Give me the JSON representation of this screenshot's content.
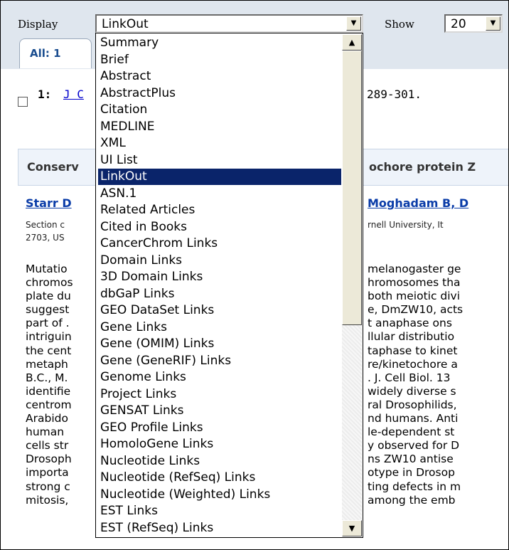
{
  "toolbar": {
    "display_label": "Display",
    "display_value": "LinkOut",
    "show_label": "Show",
    "show_value": "20",
    "dropdown_arrow_icon": "chevron-down-icon"
  },
  "tabs": [
    {
      "label": "All: 1"
    }
  ],
  "result": {
    "number": "1:",
    "link_text": "J C",
    "citation_tail": "289-301."
  },
  "article": {
    "title_left": "Conserv",
    "title_right": "ochore protein Z",
    "authors_left": "Starr D",
    "authors_right": "Moghadam B, D",
    "affiliation_line1_left": "Section c",
    "affiliation_line1_right": "rnell University, It",
    "affiliation_line2_left": "2703, US",
    "abstract_left": [
      "Mutatio",
      "chromos",
      "plate du",
      "suggest",
      "part of .",
      "intriguin",
      "the cent",
      "metaph",
      "B.C., M.",
      "identifie",
      "centrom",
      "Arabido",
      "human",
      "cells str",
      "Drosoph",
      "importa",
      "strong c",
      "mitosis,"
    ],
    "abstract_right": [
      "melanogaster ge",
      "hromosomes tha",
      "both meiotic divi",
      "e, DmZW10, acts",
      "t anaphase ons",
      "llular distributio",
      "taphase to kinet",
      "re/kinetochore a",
      ". J. Cell Biol. 13",
      "widely diverse s",
      "ral Drosophilids,",
      "nd humans. Anti",
      "le-dependent st",
      "y observed for D",
      "ns ZW10 antise",
      "otype in Drosop",
      "ting defects in m",
      "among the emb"
    ]
  },
  "dropdown": {
    "options": [
      "Summary",
      "Brief",
      "Abstract",
      "AbstractPlus",
      "Citation",
      "MEDLINE",
      "XML",
      "UI List",
      "LinkOut",
      "ASN.1",
      "Related Articles",
      "Cited in Books",
      "CancerChrom Links",
      "Domain Links",
      "3D Domain Links",
      "dbGaP Links",
      "GEO DataSet Links",
      "Gene Links",
      "Gene (OMIM) Links",
      "Gene (GeneRIF) Links",
      "Genome Links",
      "Project Links",
      "GENSAT Links",
      "GEO Profile Links",
      "HomoloGene Links",
      "Nucleotide Links",
      "Nucleotide (RefSeq) Links",
      "Nucleotide (Weighted) Links",
      "EST Links",
      "EST (RefSeq) Links"
    ],
    "selected": "LinkOut",
    "scroll_up_icon": "arrow-up-icon",
    "scroll_down_icon": "arrow-down-icon"
  }
}
